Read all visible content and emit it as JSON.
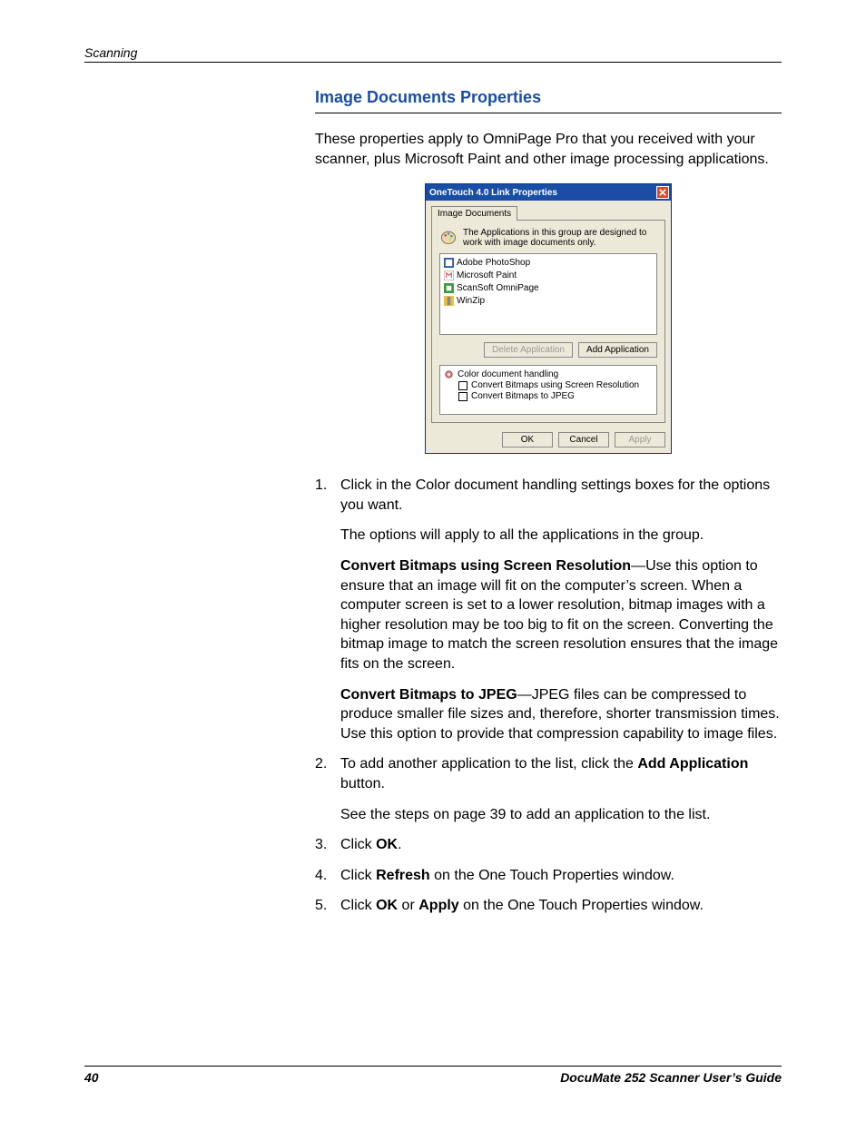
{
  "header": {
    "running": "Scanning"
  },
  "title": "Image Documents Properties",
  "intro": "These properties apply to OmniPage Pro that you received with your scanner, plus Microsoft Paint and other image processing applications.",
  "dialog": {
    "title": "OneTouch 4.0 Link Properties",
    "tab": "Image Documents",
    "group_desc": "The Applications in this group are designed to work with image documents only.",
    "apps": [
      "Adobe PhotoShop",
      "Microsoft Paint",
      "ScanSoft OmniPage",
      "WinZip"
    ],
    "delete_btn": "Delete Application",
    "add_btn": "Add Application",
    "opts_head": "Color document handling",
    "opt1": "Convert Bitmaps using Screen Resolution",
    "opt2": "Convert Bitmaps to JPEG",
    "ok": "OK",
    "cancel": "Cancel",
    "apply": "Apply"
  },
  "steps": {
    "s1": "Click in the Color document handling settings boxes for the options you want.",
    "s1b": "The options will apply to all the applications in the group.",
    "s1c_b": "Convert Bitmaps using Screen Resolution",
    "s1c": "—Use this option to ensure that an image will fit on the computer’s screen. When a computer screen is set to a lower resolution, bitmap images with a higher resolution may be too big to fit on the screen. Converting the bitmap image to match the screen resolution ensures that the image fits on the screen.",
    "s1d_b": "Convert Bitmaps to JPEG",
    "s1d": "—JPEG files can be compressed to produce smaller file sizes and, therefore, shorter transmission times. Use this option to provide that compression capability to image files.",
    "s2a": "To add another application to the list, click the ",
    "s2b": "Add Application",
    "s2c": " button.",
    "s2d": "See the steps on page 39 to add an application to the list.",
    "s3a": "Click ",
    "s3b": "OK",
    "s3c": ".",
    "s4a": "Click ",
    "s4b": "Refresh",
    "s4c": " on the One Touch Properties window.",
    "s5a": "Click ",
    "s5b": "OK",
    "s5c": " or ",
    "s5d": "Apply",
    "s5e": " on the One Touch Properties window."
  },
  "footer": {
    "page": "40",
    "book": "DocuMate 252 Scanner User’s Guide"
  }
}
